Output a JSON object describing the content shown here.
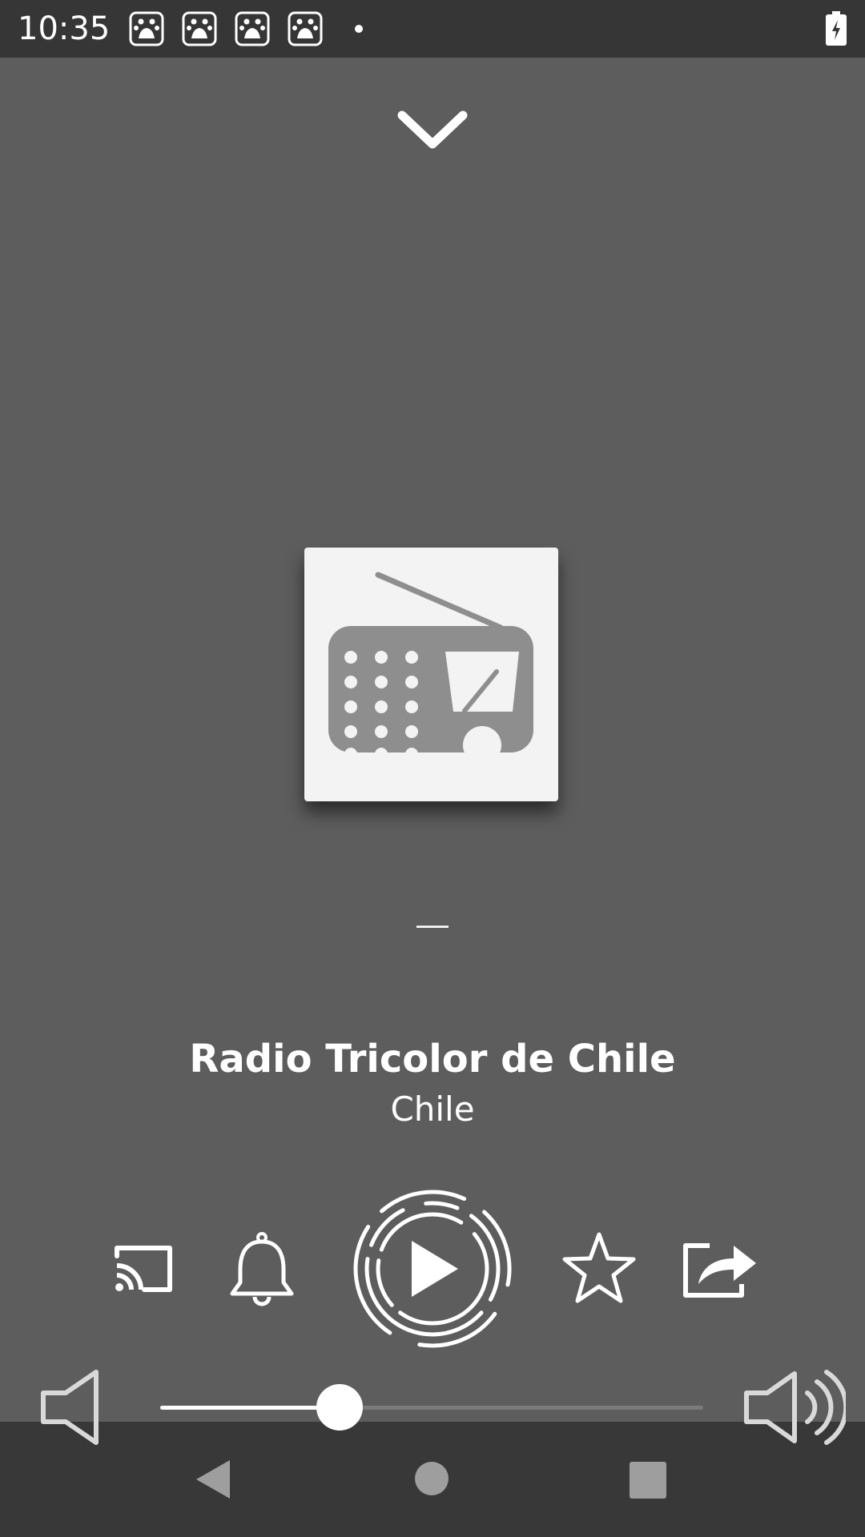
{
  "status_bar": {
    "time": "10:35",
    "notification_icons": [
      "baidu-icon",
      "baidu-icon",
      "baidu-icon",
      "baidu-icon"
    ],
    "battery_icon": "battery-charging-icon"
  },
  "player": {
    "collapse_icon": "chevron-down-icon",
    "artwork_icon": "radio-icon",
    "track_title": "—",
    "station_name": "Radio Tricolor de Chile",
    "station_country": "Chile"
  },
  "controls": {
    "cast_icon": "cast-icon",
    "alarm_icon": "bell-icon",
    "play_icon": "play-icon",
    "favorite_icon": "star-icon",
    "share_icon": "share-icon"
  },
  "volume": {
    "level": 0.33,
    "min_icon": "volume-low-icon",
    "max_icon": "volume-high-icon"
  },
  "nav_bar": {
    "back_icon": "back-icon",
    "home_icon": "home-icon",
    "recents_icon": "recents-icon"
  },
  "colors": {
    "background": "#5d5d5d",
    "status_bar": "#363636",
    "nav_bar": "#373737",
    "artwork_bg": "#f3f3f3",
    "artwork_icon": "#8e8e8e",
    "foreground": "#ffffff"
  }
}
